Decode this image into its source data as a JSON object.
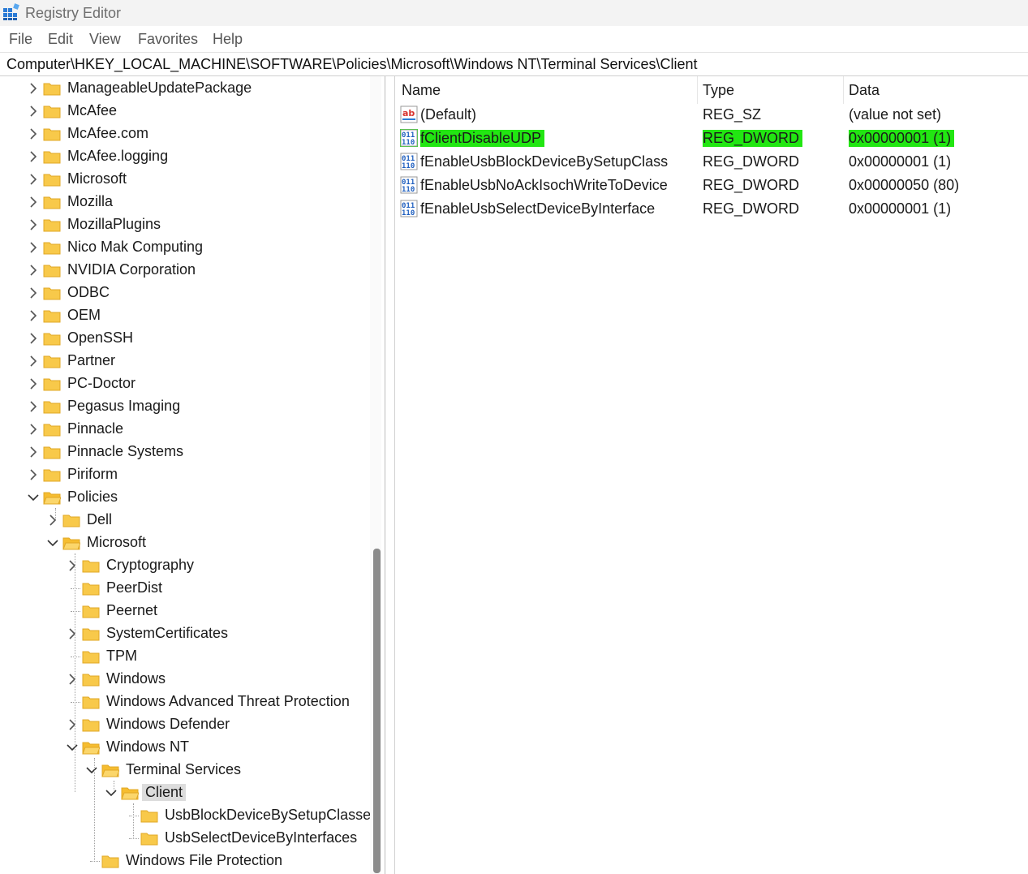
{
  "window": {
    "title": "Registry Editor"
  },
  "menu": [
    "File",
    "Edit",
    "View",
    "Favorites",
    "Help"
  ],
  "address": "Computer\\HKEY_LOCAL_MACHINE\\SOFTWARE\\Policies\\Microsoft\\Windows NT\\Terminal Services\\Client",
  "tree": [
    {
      "label": "ManageableUpdatePackage",
      "level": 0,
      "expander": "collapsed"
    },
    {
      "label": "McAfee",
      "level": 0,
      "expander": "collapsed"
    },
    {
      "label": "McAfee.com",
      "level": 0,
      "expander": "collapsed"
    },
    {
      "label": "McAfee.logging",
      "level": 0,
      "expander": "collapsed"
    },
    {
      "label": "Microsoft",
      "level": 0,
      "expander": "collapsed"
    },
    {
      "label": "Mozilla",
      "level": 0,
      "expander": "collapsed"
    },
    {
      "label": "MozillaPlugins",
      "level": 0,
      "expander": "collapsed"
    },
    {
      "label": "Nico Mak Computing",
      "level": 0,
      "expander": "collapsed"
    },
    {
      "label": "NVIDIA Corporation",
      "level": 0,
      "expander": "collapsed"
    },
    {
      "label": "ODBC",
      "level": 0,
      "expander": "collapsed"
    },
    {
      "label": "OEM",
      "level": 0,
      "expander": "collapsed"
    },
    {
      "label": "OpenSSH",
      "level": 0,
      "expander": "collapsed"
    },
    {
      "label": "Partner",
      "level": 0,
      "expander": "collapsed"
    },
    {
      "label": "PC-Doctor",
      "level": 0,
      "expander": "collapsed"
    },
    {
      "label": "Pegasus Imaging",
      "level": 0,
      "expander": "collapsed"
    },
    {
      "label": "Pinnacle",
      "level": 0,
      "expander": "collapsed"
    },
    {
      "label": "Pinnacle Systems",
      "level": 0,
      "expander": "collapsed"
    },
    {
      "label": "Piriform",
      "level": 0,
      "expander": "collapsed"
    },
    {
      "label": "Policies",
      "level": 0,
      "expander": "expanded"
    },
    {
      "label": "Dell",
      "level": 1,
      "expander": "collapsed"
    },
    {
      "label": "Microsoft",
      "level": 1,
      "expander": "expanded"
    },
    {
      "label": "Cryptography",
      "level": 2,
      "expander": "collapsed"
    },
    {
      "label": "PeerDist",
      "level": 2,
      "expander": "none"
    },
    {
      "label": "Peernet",
      "level": 2,
      "expander": "none"
    },
    {
      "label": "SystemCertificates",
      "level": 2,
      "expander": "collapsed"
    },
    {
      "label": "TPM",
      "level": 2,
      "expander": "none"
    },
    {
      "label": "Windows",
      "level": 2,
      "expander": "collapsed"
    },
    {
      "label": "Windows Advanced Threat Protection",
      "level": 2,
      "expander": "none"
    },
    {
      "label": "Windows Defender",
      "level": 2,
      "expander": "collapsed"
    },
    {
      "label": "Windows NT",
      "level": 2,
      "expander": "expanded"
    },
    {
      "label": "Terminal Services",
      "level": 3,
      "expander": "expanded"
    },
    {
      "label": "Client",
      "level": 4,
      "expander": "expanded",
      "selected": true
    },
    {
      "label": "UsbBlockDeviceBySetupClasses",
      "level": 5,
      "expander": "none"
    },
    {
      "label": "UsbSelectDeviceByInterfaces",
      "level": 5,
      "expander": "none"
    },
    {
      "label": "Windows File Protection",
      "level": 3,
      "expander": "none"
    }
  ],
  "values": {
    "columns": {
      "name": "Name",
      "type": "Type",
      "data": "Data"
    },
    "rows": [
      {
        "name": "(Default)",
        "type": "REG_SZ",
        "data": "(value not set)",
        "icon": "string-value-icon",
        "highlight": false
      },
      {
        "name": "fClientDisableUDP",
        "type": "REG_DWORD",
        "data": "0x00000001 (1)",
        "icon": "binary-value-icon",
        "highlight": true
      },
      {
        "name": "fEnableUsbBlockDeviceBySetupClass",
        "type": "REG_DWORD",
        "data": "0x00000001 (1)",
        "icon": "binary-value-icon",
        "highlight": false
      },
      {
        "name": "fEnableUsbNoAckIsochWriteToDevice",
        "type": "REG_DWORD",
        "data": "0x00000050 (80)",
        "icon": "binary-value-icon",
        "highlight": false
      },
      {
        "name": "fEnableUsbSelectDeviceByInterface",
        "type": "REG_DWORD",
        "data": "0x00000001 (1)",
        "icon": "binary-value-icon",
        "highlight": false
      }
    ]
  },
  "colors": {
    "highlight": "#22e612",
    "folder": "#f8c94a",
    "selection": "#dcdcdc"
  }
}
